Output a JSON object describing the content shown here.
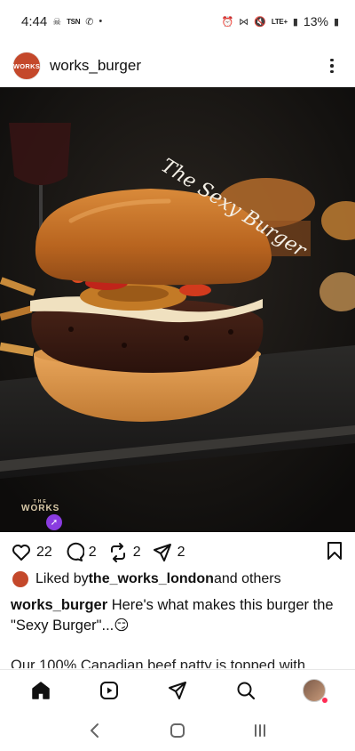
{
  "status_bar": {
    "time": "4:44",
    "carrier_small": "TSN",
    "network": "LTE+",
    "battery": "13%"
  },
  "post": {
    "username": "works_burger",
    "avatar_text": "WORKS",
    "image_script_text": "The Sexy Burger",
    "watermark_small": "THE",
    "watermark": "WORKS",
    "like_count": "22",
    "comment_count": "2",
    "repost_count": "2",
    "share_count": "2",
    "liked_by_prefix": "Liked by ",
    "liked_by_user": "the_works_london",
    "liked_by_suffix": " and others",
    "caption_user": "works_burger",
    "caption_text": " Here's what makes this burger the \"Sexy Burger\"...😏",
    "caption_more": "Our 100% Canadian beef patty is topped with"
  },
  "icons": {
    "more": "more-options-icon",
    "like": "heart-icon",
    "comment": "comment-icon",
    "repost": "repost-icon",
    "share": "send-icon",
    "bookmark": "bookmark-icon",
    "home": "home-icon",
    "reels": "reels-icon",
    "messages": "direct-icon",
    "search": "search-icon"
  }
}
